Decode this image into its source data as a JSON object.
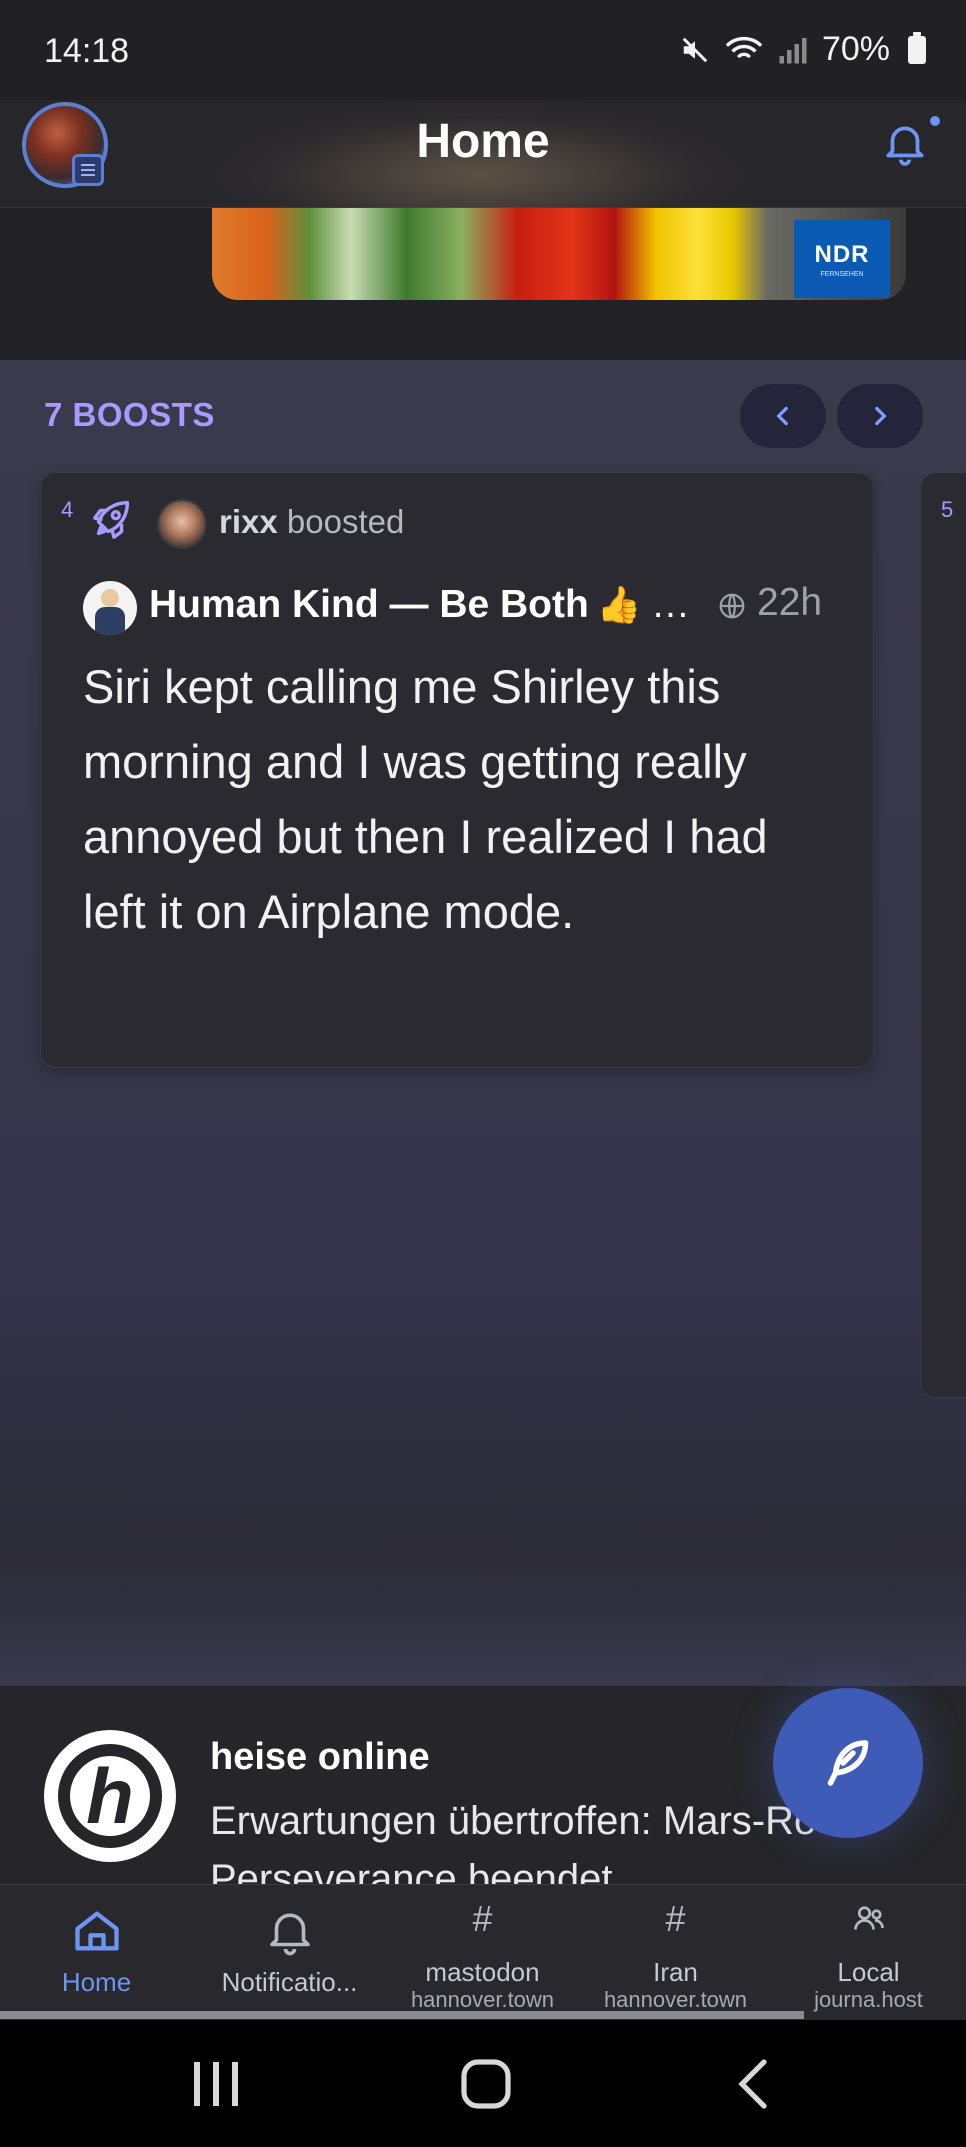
{
  "status_bar": {
    "time": "14:18",
    "battery": "70%"
  },
  "header": {
    "title": "Home"
  },
  "previous_post": {
    "image_logo": "NDR",
    "image_logo_sub": "FERNSEHEN"
  },
  "boosts": {
    "title": "7 BOOSTS",
    "cards": [
      {
        "index": "4",
        "booster_name": "rixx",
        "booster_action": "boosted",
        "author": "Human Kind — Be Both",
        "author_emoji": "👍",
        "ellipsis": "…",
        "visibility_icon": "globe-icon",
        "time": "22h",
        "text": "Siri kept calling me Shirley this morning and I was getting really annoyed but then I realized I had left it on Airplane mode."
      },
      {
        "index": "5"
      }
    ]
  },
  "news": {
    "source": "heise online",
    "text": "Erwartungen übertroffen: Mars-Rover Perseverance beendet"
  },
  "bottom_nav": [
    {
      "label": "Home",
      "sub": "",
      "icon": "home-icon",
      "active": true
    },
    {
      "label": "Notificatio...",
      "sub": "",
      "icon": "bell-icon",
      "active": false
    },
    {
      "label": "mastodon",
      "sub": "hannover.town",
      "icon": "hash-icon",
      "active": false
    },
    {
      "label": "Iran",
      "sub": "hannover.town",
      "icon": "hash-icon",
      "active": false
    },
    {
      "label": "Local",
      "sub": "journa.host",
      "icon": "users-icon",
      "active": false
    }
  ],
  "colors": {
    "accent": "#6f95f2",
    "boost_accent": "#a79bff",
    "fab": "#3f5bb8"
  }
}
